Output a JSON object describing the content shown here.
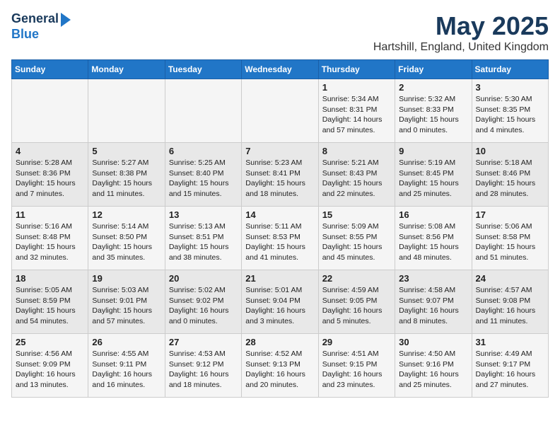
{
  "header": {
    "logo_line1": "General",
    "logo_line2": "Blue",
    "month": "May 2025",
    "location": "Hartshill, England, United Kingdom"
  },
  "days_of_week": [
    "Sunday",
    "Monday",
    "Tuesday",
    "Wednesday",
    "Thursday",
    "Friday",
    "Saturday"
  ],
  "weeks": [
    [
      {
        "day": "",
        "info": ""
      },
      {
        "day": "",
        "info": ""
      },
      {
        "day": "",
        "info": ""
      },
      {
        "day": "",
        "info": ""
      },
      {
        "day": "1",
        "info": "Sunrise: 5:34 AM\nSunset: 8:31 PM\nDaylight: 14 hours and 57 minutes."
      },
      {
        "day": "2",
        "info": "Sunrise: 5:32 AM\nSunset: 8:33 PM\nDaylight: 15 hours and 0 minutes."
      },
      {
        "day": "3",
        "info": "Sunrise: 5:30 AM\nSunset: 8:35 PM\nDaylight: 15 hours and 4 minutes."
      }
    ],
    [
      {
        "day": "4",
        "info": "Sunrise: 5:28 AM\nSunset: 8:36 PM\nDaylight: 15 hours and 7 minutes."
      },
      {
        "day": "5",
        "info": "Sunrise: 5:27 AM\nSunset: 8:38 PM\nDaylight: 15 hours and 11 minutes."
      },
      {
        "day": "6",
        "info": "Sunrise: 5:25 AM\nSunset: 8:40 PM\nDaylight: 15 hours and 15 minutes."
      },
      {
        "day": "7",
        "info": "Sunrise: 5:23 AM\nSunset: 8:41 PM\nDaylight: 15 hours and 18 minutes."
      },
      {
        "day": "8",
        "info": "Sunrise: 5:21 AM\nSunset: 8:43 PM\nDaylight: 15 hours and 22 minutes."
      },
      {
        "day": "9",
        "info": "Sunrise: 5:19 AM\nSunset: 8:45 PM\nDaylight: 15 hours and 25 minutes."
      },
      {
        "day": "10",
        "info": "Sunrise: 5:18 AM\nSunset: 8:46 PM\nDaylight: 15 hours and 28 minutes."
      }
    ],
    [
      {
        "day": "11",
        "info": "Sunrise: 5:16 AM\nSunset: 8:48 PM\nDaylight: 15 hours and 32 minutes."
      },
      {
        "day": "12",
        "info": "Sunrise: 5:14 AM\nSunset: 8:50 PM\nDaylight: 15 hours and 35 minutes."
      },
      {
        "day": "13",
        "info": "Sunrise: 5:13 AM\nSunset: 8:51 PM\nDaylight: 15 hours and 38 minutes."
      },
      {
        "day": "14",
        "info": "Sunrise: 5:11 AM\nSunset: 8:53 PM\nDaylight: 15 hours and 41 minutes."
      },
      {
        "day": "15",
        "info": "Sunrise: 5:09 AM\nSunset: 8:55 PM\nDaylight: 15 hours and 45 minutes."
      },
      {
        "day": "16",
        "info": "Sunrise: 5:08 AM\nSunset: 8:56 PM\nDaylight: 15 hours and 48 minutes."
      },
      {
        "day": "17",
        "info": "Sunrise: 5:06 AM\nSunset: 8:58 PM\nDaylight: 15 hours and 51 minutes."
      }
    ],
    [
      {
        "day": "18",
        "info": "Sunrise: 5:05 AM\nSunset: 8:59 PM\nDaylight: 15 hours and 54 minutes."
      },
      {
        "day": "19",
        "info": "Sunrise: 5:03 AM\nSunset: 9:01 PM\nDaylight: 15 hours and 57 minutes."
      },
      {
        "day": "20",
        "info": "Sunrise: 5:02 AM\nSunset: 9:02 PM\nDaylight: 16 hours and 0 minutes."
      },
      {
        "day": "21",
        "info": "Sunrise: 5:01 AM\nSunset: 9:04 PM\nDaylight: 16 hours and 3 minutes."
      },
      {
        "day": "22",
        "info": "Sunrise: 4:59 AM\nSunset: 9:05 PM\nDaylight: 16 hours and 5 minutes."
      },
      {
        "day": "23",
        "info": "Sunrise: 4:58 AM\nSunset: 9:07 PM\nDaylight: 16 hours and 8 minutes."
      },
      {
        "day": "24",
        "info": "Sunrise: 4:57 AM\nSunset: 9:08 PM\nDaylight: 16 hours and 11 minutes."
      }
    ],
    [
      {
        "day": "25",
        "info": "Sunrise: 4:56 AM\nSunset: 9:09 PM\nDaylight: 16 hours and 13 minutes."
      },
      {
        "day": "26",
        "info": "Sunrise: 4:55 AM\nSunset: 9:11 PM\nDaylight: 16 hours and 16 minutes."
      },
      {
        "day": "27",
        "info": "Sunrise: 4:53 AM\nSunset: 9:12 PM\nDaylight: 16 hours and 18 minutes."
      },
      {
        "day": "28",
        "info": "Sunrise: 4:52 AM\nSunset: 9:13 PM\nDaylight: 16 hours and 20 minutes."
      },
      {
        "day": "29",
        "info": "Sunrise: 4:51 AM\nSunset: 9:15 PM\nDaylight: 16 hours and 23 minutes."
      },
      {
        "day": "30",
        "info": "Sunrise: 4:50 AM\nSunset: 9:16 PM\nDaylight: 16 hours and 25 minutes."
      },
      {
        "day": "31",
        "info": "Sunrise: 4:49 AM\nSunset: 9:17 PM\nDaylight: 16 hours and 27 minutes."
      }
    ]
  ]
}
